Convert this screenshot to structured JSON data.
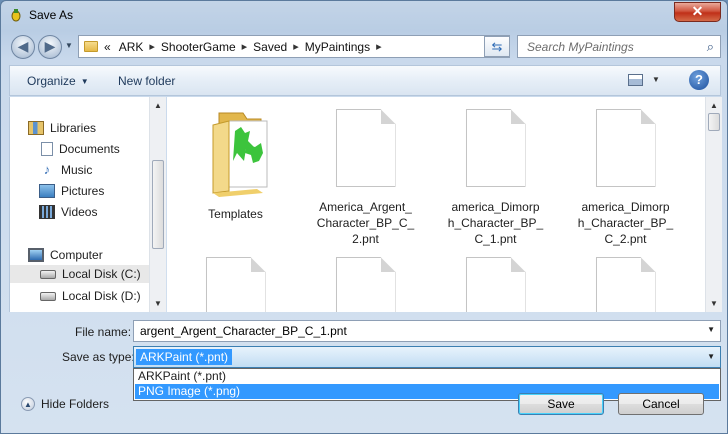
{
  "window": {
    "title": "Save As",
    "close_label": "✕"
  },
  "nav": {
    "back_icon": "back-arrow-icon",
    "forward_icon": "forward-arrow-icon",
    "breadcrumb": [
      "ARK",
      "ShooterGame",
      "Saved",
      "MyPaintings"
    ],
    "breadcrumb_prefix": "«",
    "search_placeholder": "Search MyPaintings"
  },
  "toolbar": {
    "organize_label": "Organize",
    "new_folder_label": "New folder"
  },
  "sidebar": {
    "libraries": {
      "label": "Libraries",
      "icon": "libraries-icon"
    },
    "library_items": [
      {
        "label": "Documents",
        "icon": "documents-icon"
      },
      {
        "label": "Music",
        "icon": "music-icon"
      },
      {
        "label": "Pictures",
        "icon": "pictures-icon"
      },
      {
        "label": "Videos",
        "icon": "videos-icon"
      }
    ],
    "computer": {
      "label": "Computer",
      "icon": "computer-icon"
    },
    "drives": [
      {
        "label": "Local Disk (C:)",
        "selected": true
      },
      {
        "label": "Local Disk (D:)",
        "selected": false
      }
    ]
  },
  "files": [
    {
      "label": "Templates",
      "type": "folder"
    },
    {
      "label": "America_Argent_\nCharacter_BP_C_\n2.pnt",
      "type": "file"
    },
    {
      "label": "america_Dimorp\nh_Character_BP_\nC_1.pnt",
      "type": "file"
    },
    {
      "label": "america_Dimorp\nh_Character_BP_\nC_2.pnt",
      "type": "file"
    },
    {
      "label": "",
      "type": "file"
    },
    {
      "label": "",
      "type": "file"
    },
    {
      "label": "",
      "type": "file"
    },
    {
      "label": "",
      "type": "file"
    }
  ],
  "form": {
    "file_name_label": "File name:",
    "file_name_value": "argent_Argent_Character_BP_C_1.pnt",
    "save_type_label": "Save as type:",
    "save_type_value": "ARKPaint (*.pnt)",
    "save_type_options": [
      "ARKPaint (*.pnt)",
      "PNG Image (*.png)"
    ],
    "highlighted_option": 1
  },
  "footer": {
    "hide_folders_label": "Hide Folders",
    "save_label": "Save",
    "cancel_label": "Cancel"
  },
  "colors": {
    "selection": "#3399ff",
    "close_button": "#c9462c",
    "folder": "#f0cf6b",
    "green_art": "#3cc43c"
  }
}
